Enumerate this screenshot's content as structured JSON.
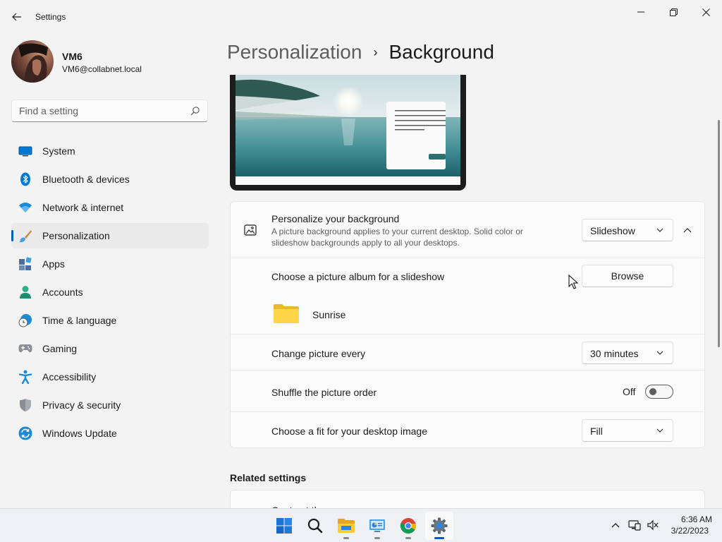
{
  "window": {
    "title": "Settings"
  },
  "profile": {
    "name": "VM6",
    "email": "VM6@collabnet.local"
  },
  "search": {
    "placeholder": "Find a setting"
  },
  "nav": {
    "items": [
      {
        "label": "System",
        "icon": "system-icon",
        "active": false
      },
      {
        "label": "Bluetooth & devices",
        "icon": "bluetooth-icon",
        "active": false
      },
      {
        "label": "Network & internet",
        "icon": "wifi-icon",
        "active": false
      },
      {
        "label": "Personalization",
        "icon": "brush-icon",
        "active": true
      },
      {
        "label": "Apps",
        "icon": "apps-icon",
        "active": false
      },
      {
        "label": "Accounts",
        "icon": "accounts-icon",
        "active": false
      },
      {
        "label": "Time & language",
        "icon": "clock-globe-icon",
        "active": false
      },
      {
        "label": "Gaming",
        "icon": "gamepad-icon",
        "active": false
      },
      {
        "label": "Accessibility",
        "icon": "accessibility-icon",
        "active": false
      },
      {
        "label": "Privacy & security",
        "icon": "shield-icon",
        "active": false
      },
      {
        "label": "Windows Update",
        "icon": "update-icon",
        "active": false
      }
    ]
  },
  "header": {
    "parent": "Personalization",
    "separator": "›",
    "current": "Background"
  },
  "background": {
    "personalize": {
      "title": "Personalize your background",
      "description": "A picture background applies to your current desktop. Solid color or slideshow backgrounds apply to all your desktops.",
      "value": "Slideshow"
    },
    "album": {
      "title": "Choose a picture album for a slideshow",
      "button": "Browse",
      "folder": "Sunrise"
    },
    "interval": {
      "title": "Change picture every",
      "value": "30 minutes"
    },
    "shuffle": {
      "title": "Shuffle the picture order",
      "state": "Off",
      "on": false
    },
    "fit": {
      "title": "Choose a fit for your desktop image",
      "value": "Fill"
    }
  },
  "related": {
    "title": "Related settings",
    "first_item": "Contrast themes"
  },
  "taskbar": {
    "apps": [
      {
        "icon": "windows-start-icon"
      },
      {
        "icon": "search-icon"
      },
      {
        "icon": "file-explorer-icon"
      },
      {
        "icon": "control-panel-icon"
      },
      {
        "icon": "chrome-icon"
      },
      {
        "icon": "settings-gear-icon"
      }
    ],
    "time": "6:36 AM",
    "date": "3/22/2023"
  },
  "colors": {
    "accent": "#005fb8",
    "background": "#f3f3f3",
    "card": "#fbfbfb"
  }
}
